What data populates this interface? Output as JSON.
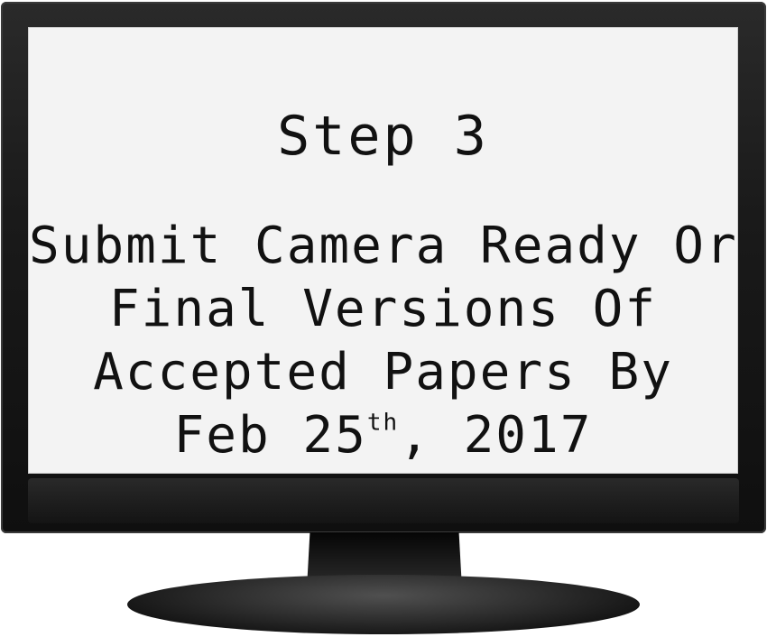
{
  "screen": {
    "title": "Step 3",
    "lines": [
      "Submit Camera Ready Or",
      "Final Versions Of",
      "Accepted Papers By"
    ],
    "date": {
      "prefix": "Feb 25",
      "superscript": "th",
      "suffix": ", 2017"
    }
  },
  "colors": {
    "frame": "#1a1a1a",
    "screen": "#f3f3f3",
    "text": "#111111"
  }
}
